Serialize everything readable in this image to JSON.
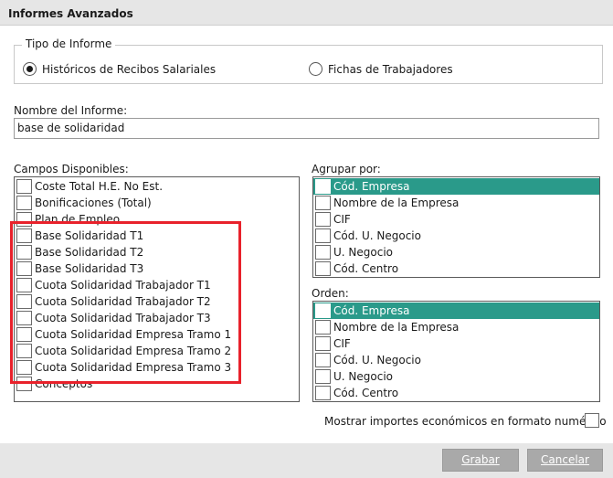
{
  "window": {
    "title": "Informes Avanzados"
  },
  "tipo_informe": {
    "legend": "Tipo de Informe",
    "options": [
      {
        "label": "Históricos de Recibos Salariales",
        "checked": true
      },
      {
        "label": "Fichas de Trabajadores",
        "checked": false
      }
    ]
  },
  "nombre": {
    "label": "Nombre del Informe:",
    "value": "base de solidaridad"
  },
  "campos": {
    "label": "Campos Disponibles:",
    "items": [
      "Coste Total H.E. No Est.",
      "Bonificaciones (Total)",
      "Plan de Empleo",
      "Base Solidaridad T1",
      "Base Solidaridad T2",
      "Base Solidaridad T3",
      "Cuota Solidaridad Trabajador T1",
      "Cuota Solidaridad Trabajador T2",
      "Cuota Solidaridad Trabajador T3",
      "Cuota Solidaridad Empresa Tramo 1",
      "Cuota Solidaridad Empresa Tramo 2",
      "Cuota Solidaridad Empresa Tramo 3",
      "Conceptos"
    ]
  },
  "agrupar": {
    "label": "Agrupar por:",
    "items": [
      "Cód. Empresa",
      "Nombre de la Empresa",
      "CIF",
      "Cód. U. Negocio",
      "U. Negocio",
      "Cód. Centro"
    ],
    "selected_index": 0
  },
  "orden": {
    "label": "Orden:",
    "items": [
      "Cód. Empresa",
      "Nombre de la Empresa",
      "CIF",
      "Cód. U. Negocio",
      "U. Negocio",
      "Cód. Centro"
    ],
    "selected_index": 0
  },
  "formato": {
    "label": "Mostrar importes económicos en formato numérico",
    "checked": false
  },
  "buttons": {
    "grabar": "Grabar",
    "cancelar": "Cancelar"
  },
  "colors": {
    "selection": "#2a9a8a",
    "highlight": "#e8212b",
    "button": "#a9a9a9"
  }
}
